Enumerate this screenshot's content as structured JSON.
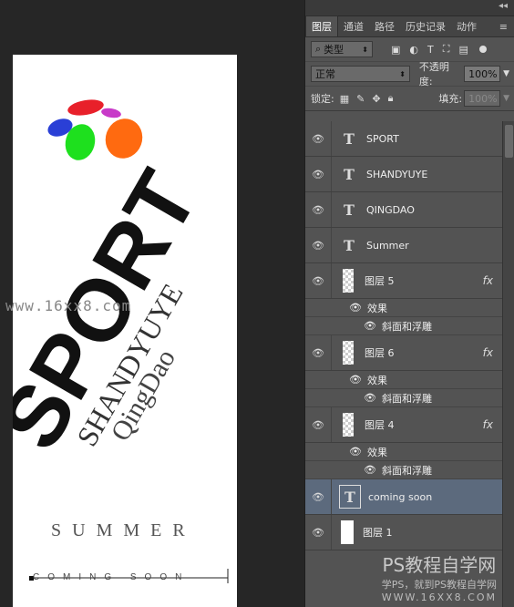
{
  "panel": {
    "tabs": [
      "图层",
      "通道",
      "路径",
      "历史记录",
      "动作"
    ],
    "active_tab_index": 0,
    "filter_label": "类型",
    "blend_mode": "正常",
    "opacity_label": "不透明度:",
    "opacity_value": "100%",
    "lock_label": "锁定:",
    "fill_label": "填充:",
    "fill_value": "100%",
    "layers": [
      {
        "name": "SPORT",
        "type": "text"
      },
      {
        "name": "SHANDYUYE",
        "type": "text"
      },
      {
        "name": "QINGDAO",
        "type": "text"
      },
      {
        "name": "Summer",
        "type": "text"
      },
      {
        "name": "图层 5",
        "type": "raster",
        "fx": "fx",
        "effects_label": "效果",
        "effect": "斜面和浮雕"
      },
      {
        "name": "图层 6",
        "type": "raster",
        "fx": "fx",
        "effects_label": "效果",
        "effect": "斜面和浮雕"
      },
      {
        "name": "图层 4",
        "type": "raster",
        "fx": "fx",
        "effects_label": "效果",
        "effect": "斜面和浮雕"
      },
      {
        "name": "coming soon",
        "type": "text",
        "selected": true
      },
      {
        "name": "图层 1",
        "type": "white"
      }
    ]
  },
  "artwork": {
    "sport": "SPORT",
    "shandyuye": "SHANDYUYE",
    "qingdao": "QingDao",
    "summer": "SUMMER",
    "coming_soon": "COMING SOON",
    "overlay_text": "www.16xx8.com",
    "colors": {
      "red": "#e8261e",
      "black": "#111111",
      "gray": "#444444"
    }
  },
  "watermark": {
    "line1": "PS教程自学网",
    "line2": "学PS，就到PS教程自学网",
    "line3": "WWW.16XX8.COM"
  }
}
